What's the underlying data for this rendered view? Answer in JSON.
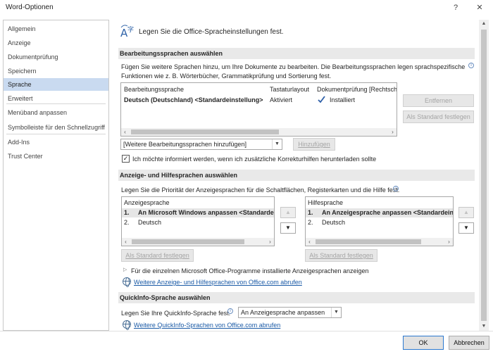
{
  "window": {
    "title": "Word-Optionen",
    "help_glyph": "?",
    "close_glyph": "✕"
  },
  "nav": {
    "items": [
      {
        "label": "Allgemein"
      },
      {
        "label": "Anzeige"
      },
      {
        "label": "Dokumentprüfung"
      },
      {
        "label": "Speichern"
      },
      {
        "label": "Sprache",
        "selected": true
      },
      {
        "label": "Erweitert"
      },
      {
        "label": "Menüband anpassen"
      },
      {
        "label": "Symbolleiste für den Schnellzugriff"
      },
      {
        "label": "Add-Ins"
      },
      {
        "label": "Trust Center"
      }
    ]
  },
  "header": {
    "text": "Legen Sie die Office-Spracheinstellungen fest."
  },
  "editing": {
    "section_title": "Bearbeitungssprachen auswählen",
    "description_line1": "Fügen Sie weitere Sprachen hinzu, um Ihre Dokumente zu bearbeiten. Die Bearbeitungssprachen legen sprachspezifische",
    "description_line2": "Funktionen wie z. B. Wörterbücher, Grammatikprüfung und Sortierung fest.",
    "table": {
      "columns": [
        "Bearbeitungssprache",
        "Tastaturlayout",
        "Dokumentprüfung [Rechtsch"
      ],
      "rows": [
        {
          "language": "Deutsch (Deutschland) <Standardeinstellung>",
          "keyboard": "Aktiviert",
          "proofing": "Installiert"
        }
      ]
    },
    "remove_label": "Entfernen",
    "set_default_label": "Als Standard festlegen",
    "add_combo_value": "[Weitere Bearbeitungssprachen hinzufügen]",
    "add_button_label": "Hinzufügen",
    "notify_checkbox_label": "Ich möchte informiert werden, wenn ich zusätzliche Korrekturhilfen herunterladen sollte",
    "notify_checked": true
  },
  "display": {
    "section_title": "Anzeige- und Hilfesprachen auswählen",
    "description": "Legen Sie die Priorität der Anzeigesprachen für die Schaltflächen, Registerkarten und die Hilfe fest.",
    "display_list": {
      "header": "Anzeigesprache",
      "items": [
        {
          "num": "1.",
          "label": "An Microsoft Windows anpassen <Standardei"
        },
        {
          "num": "2.",
          "label": "Deutsch"
        }
      ]
    },
    "help_list": {
      "header": "Hilfesprache",
      "items": [
        {
          "num": "1.",
          "label": "An Anzeigesprache anpassen <Standardeins"
        },
        {
          "num": "2.",
          "label": "Deutsch"
        }
      ]
    },
    "set_default_display_label": "Als Standard festlegen",
    "set_default_help_label": "Als Standard festlegen",
    "installed_langs_text": "Für die einzelnen Microsoft Office-Programme installierte Anzeigesprachen anzeigen",
    "more_langs_link": "Weitere Anzeige- und Hilfesprachen von Office.com abrufen"
  },
  "quickinfo": {
    "section_title": "QuickInfo-Sprache auswählen",
    "label": "Legen Sie Ihre QuickInfo-Sprache fest.",
    "combo_value": "An Anzeigesprache anpassen",
    "more_link": "Weitere QuickInfo-Sprachen von Office.com abrufen"
  },
  "footer": {
    "ok_label": "OK",
    "cancel_label": "Abbrechen"
  }
}
